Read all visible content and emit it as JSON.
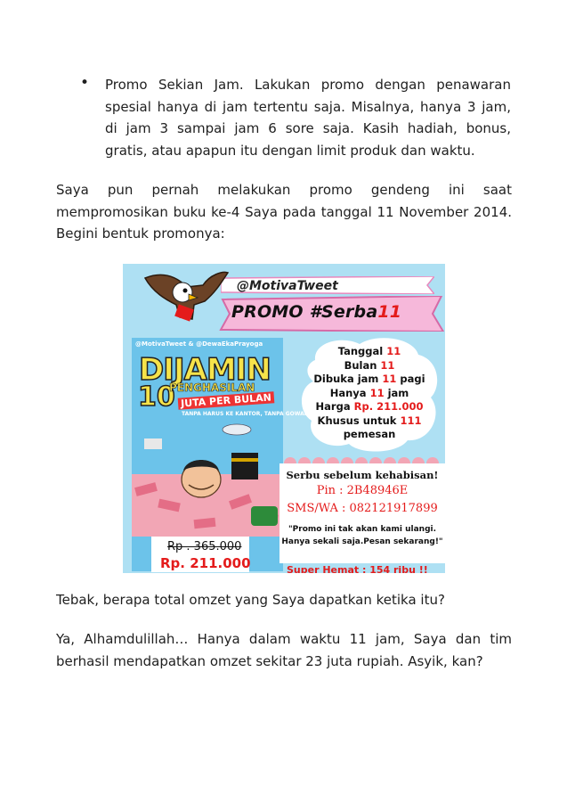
{
  "bullet": {
    "dot": "•",
    "text": "Promo Sekian Jam. Lakukan promo dengan penawaran spesial hanya di jam tertentu saja. Misalnya, hanya 3 jam, di jam 3 sampai jam 6 sore saja. Kasih hadiah, bonus, gratis, atau apapun itu dengan limit produk dan waktu."
  },
  "paragraphs": {
    "p1": "Saya pun pernah melakukan promo gendeng ini saat mempromosikan buku ke-4 Saya pada tanggal 11 November 2014. Begini bentuk promonya:",
    "p2": "Tebak, berapa total omzet yang Saya dapatkan ketika itu?",
    "p3": "Ya, Alhamdulillah… Hanya dalam waktu 11 jam, Saya dan tim berhasil mendapatkan omzet sekitar 23 juta rupiah. Asyik, kan?"
  },
  "promo": {
    "handle": "@MotivaTweet",
    "ribbon_prefix": "PROMO #Serba",
    "ribbon_num": "11",
    "book": {
      "authors": "@MotivaTweet & @DewaEkaPrayoga",
      "title": "DIJAMIN",
      "number": "10",
      "subtitle1": "PENGHASILAN",
      "subtitle2": "JUTA PER BULAN",
      "subtitle3": "TANPA HARUS KE KANTOR, TANPA GOWANK KE DUKUN"
    },
    "info": {
      "l1a": "Tanggal ",
      "l1b": "11",
      "l2a": "Bulan ",
      "l2b": "11",
      "l3a": "Dibuka jam ",
      "l3b": "11",
      "l3c": " pagi",
      "l4a": "Hanya ",
      "l4b": "11",
      "l4c": " jam",
      "l5a": "Harga ",
      "l5b": "Rp. 211.000",
      "l6a": "Khusus untuk ",
      "l6b": "111",
      "l7": "pemesan"
    },
    "box": {
      "line1": "Serbu sebelum kehabisan!",
      "line2": "Pin : 2B48946E",
      "line3": "SMS/WA : 082121917899",
      "line4": "\"Promo ini tak akan kami ulangi.",
      "line5": "Hanya sekali saja.Pesan sekarang!\"",
      "line6": "Super Hemat : 154 ribu !!"
    },
    "price_old": "Rp . 365.000",
    "price_new": "Rp. 211.000",
    "colors": {
      "sky": "#aee0f3",
      "pink": "#f6b8da",
      "red": "#e41b1b",
      "yellow": "#f6e34a"
    }
  }
}
